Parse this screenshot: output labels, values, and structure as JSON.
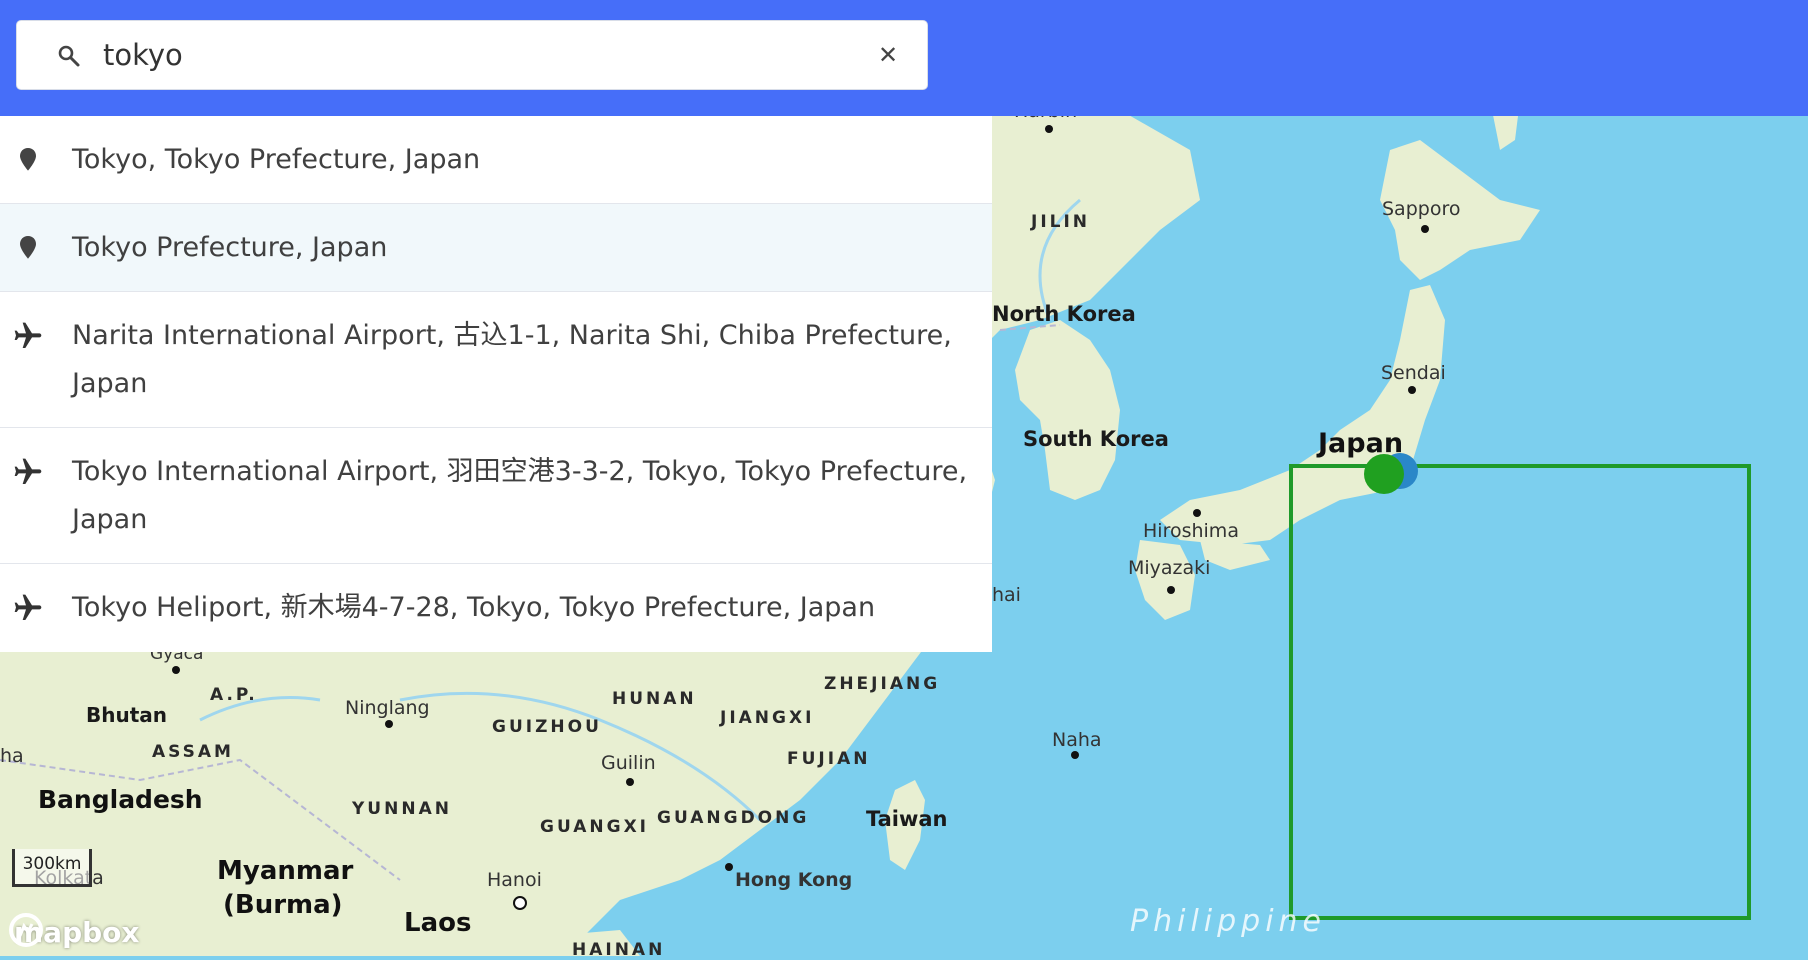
{
  "search": {
    "value": "tokyo",
    "icon": "search-icon",
    "clear_icon": "close-icon",
    "clear_glyph": "✕"
  },
  "results": [
    {
      "label": "Tokyo, Tokyo Prefecture, Japan",
      "icon": "map-pin-icon"
    },
    {
      "label": "Tokyo Prefecture, Japan",
      "icon": "map-pin-icon"
    },
    {
      "label": "Narita International Airport, 古込1-1, Narita Shi, Chiba Prefecture, Japan",
      "icon": "airplane-icon"
    },
    {
      "label": "Tokyo International Airport, 羽田空港3-3-2, Tokyo, Tokyo Prefecture, Japan",
      "icon": "airplane-icon"
    },
    {
      "label": "Tokyo Heliport, 新木場4-7-28, Tokyo, Tokyo Prefecture, Japan",
      "icon": "airplane-icon"
    }
  ],
  "map": {
    "labels": {
      "harbin": "Harbin",
      "jilin": "JILIN",
      "sapporo": "Sapporo",
      "north_korea": "North Korea",
      "sendai": "Sendai",
      "south_korea": "South Korea",
      "japan": "Japan",
      "hiroshima": "Hiroshima",
      "miyazaki": "Miyazaki",
      "shanghai_fragment": "hai",
      "gyaca": "Gyaca",
      "ap": "A.P.",
      "bhutan": "Bhutan",
      "ninglang": "Ninglang",
      "hunan": "HUNAN",
      "zhejiang": "ZHEJIANG",
      "guizhou": "GUIZHOU",
      "jiangxi": "JIANGXI",
      "assam": "ASSAM",
      "guilin": "Guilin",
      "fujian": "FUJIAN",
      "naha": "Naha",
      "bangladesh": "Bangladesh",
      "yunnan": "YUNNAN",
      "guangxi": "GUANGXI",
      "guangdong": "GUANGDONG",
      "taiwan": "Taiwan",
      "myanmar": "Myanmar",
      "burma": "(Burma)",
      "hanoi": "Hanoi",
      "hong_kong": "Hong Kong",
      "laos": "Laos",
      "kolkata": "Kolkata",
      "hainan": "HAINAN",
      "philippine": "Philippine",
      "fragment_ha": "ha"
    },
    "scale": "300km",
    "logo": "mapbox",
    "colors": {
      "water": "#7ccfee",
      "land": "#e8efd2",
      "header": "#466ef9",
      "bbox": "#1f9a2a",
      "marker_green": "#20a020",
      "marker_blue": "#2a87c8"
    }
  }
}
